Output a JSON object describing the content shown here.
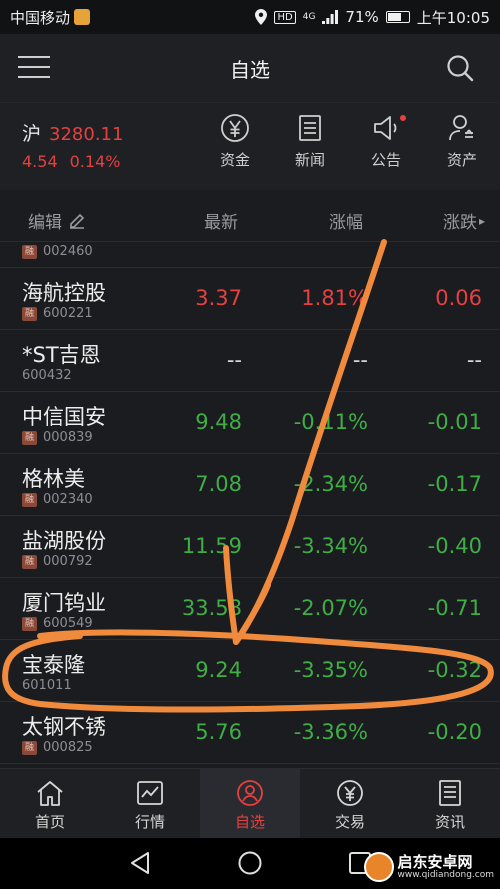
{
  "status_bar": {
    "carrier": "中国移动",
    "network": "4G",
    "battery": "71%",
    "battery_level": 0.71,
    "time": "上午10:05",
    "icons": [
      "location-icon",
      "hd-icon",
      "signal-icon",
      "battery-icon"
    ]
  },
  "nav": {
    "title": "自选",
    "menu_icon": "hamburger-menu-icon",
    "search_icon": "search-icon"
  },
  "index": {
    "market": "沪",
    "value": "3280.11",
    "change": "4.54",
    "change_pct": "0.14%"
  },
  "quick_actions": [
    {
      "label": "资金",
      "icon": "yen-circle-icon"
    },
    {
      "label": "新闻",
      "icon": "news-doc-icon"
    },
    {
      "label": "公告",
      "icon": "megaphone-icon"
    },
    {
      "label": "资产",
      "icon": "user-assets-icon"
    }
  ],
  "list_header": {
    "edit": "编辑",
    "latest": "最新",
    "change_pct": "涨幅",
    "change_amt": "涨跌"
  },
  "stocks": [
    {
      "name": "",
      "code": "002460",
      "rong": true,
      "latest": "",
      "chg": "",
      "amt": "",
      "trend": "down"
    },
    {
      "name": "海航控股",
      "code": "600221",
      "rong": true,
      "latest": "3.37",
      "chg": "1.81%",
      "amt": "0.06",
      "trend": "up"
    },
    {
      "name": "*ST吉恩",
      "code": "600432",
      "rong": false,
      "latest": "--",
      "chg": "--",
      "amt": "--",
      "trend": "flat"
    },
    {
      "name": "中信国安",
      "code": "000839",
      "rong": true,
      "latest": "9.48",
      "chg": "-0.11%",
      "amt": "-0.01",
      "trend": "down"
    },
    {
      "name": "格林美",
      "code": "002340",
      "rong": true,
      "latest": "7.08",
      "chg": "-2.34%",
      "amt": "-0.17",
      "trend": "down"
    },
    {
      "name": "盐湖股份",
      "code": "000792",
      "rong": true,
      "latest": "11.59",
      "chg": "-3.34%",
      "amt": "-0.40",
      "trend": "down"
    },
    {
      "name": "厦门钨业",
      "code": "600549",
      "rong": true,
      "latest": "33.58",
      "chg": "-2.07%",
      "amt": "-0.71",
      "trend": "down"
    },
    {
      "name": "宝泰隆",
      "code": "601011",
      "rong": false,
      "latest": "9.24",
      "chg": "-3.35%",
      "amt": "-0.32",
      "trend": "down"
    },
    {
      "name": "太钢不锈",
      "code": "000825",
      "rong": true,
      "latest": "5.76",
      "chg": "-3.36%",
      "amt": "-0.20",
      "trend": "down"
    }
  ],
  "rong_label": "融",
  "tabs": [
    {
      "label": "首页",
      "icon": "home-icon",
      "active": false
    },
    {
      "label": "行情",
      "icon": "chart-icon",
      "active": false
    },
    {
      "label": "自选",
      "icon": "watchlist-icon",
      "active": true
    },
    {
      "label": "交易",
      "icon": "trade-yen-icon",
      "active": false
    },
    {
      "label": "资讯",
      "icon": "news-icon",
      "active": false
    }
  ],
  "watermark": {
    "text": "启东安卓网",
    "url": "www.qidiandong.com"
  },
  "colors": {
    "up": "#e4413f",
    "down": "#3fae45",
    "annotation": "#f08a3c",
    "background": "#1b1c20"
  }
}
